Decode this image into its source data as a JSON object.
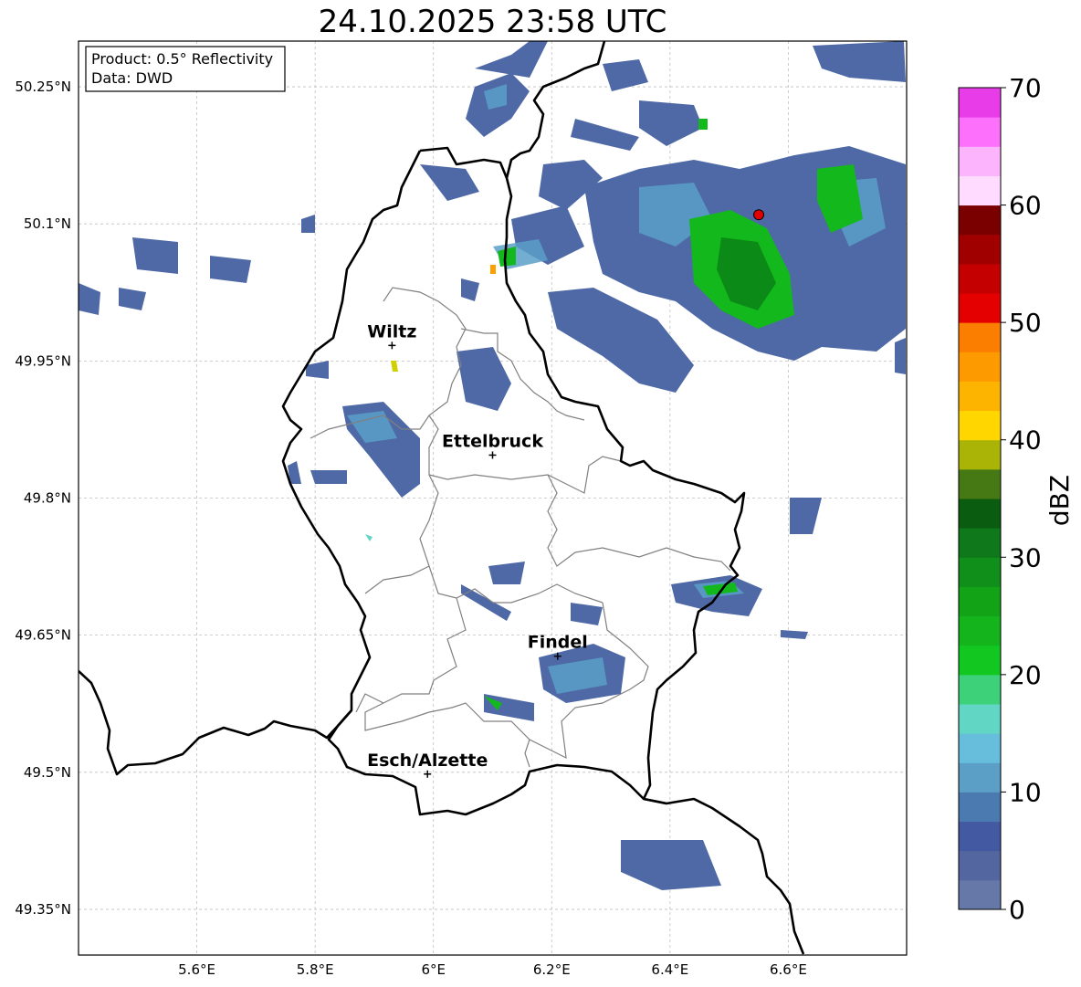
{
  "title": "24.10.2025 23:58 UTC",
  "info_box": {
    "product": "Product: 0.5° Reflectivity",
    "data": "Data: DWD"
  },
  "axes": {
    "lon_ticks": [
      "5.6°E",
      "5.8°E",
      "6°E",
      "6.2°E",
      "6.4°E",
      "6.6°E"
    ],
    "lon_values": [
      5.6,
      5.8,
      6.0,
      6.2,
      6.4,
      6.6
    ],
    "lat_ticks": [
      "50.25°N",
      "50.1°N",
      "49.95°N",
      "49.8°N",
      "49.65°N",
      "49.5°N",
      "49.35°N"
    ],
    "lat_values": [
      50.25,
      50.1,
      49.95,
      49.8,
      49.65,
      49.5,
      49.35
    ],
    "lon_range": [
      5.4,
      6.8
    ],
    "lat_range": [
      49.3,
      50.3
    ],
    "grid": true
  },
  "cities": [
    {
      "name": "Wiltz",
      "lon": 5.93,
      "lat": 49.967
    },
    {
      "name": "Ettelbruck",
      "lon": 6.1,
      "lat": 49.847
    },
    {
      "name": "Findel",
      "lon": 6.21,
      "lat": 49.627
    },
    {
      "name": "Esch/Alzette",
      "lon": 5.99,
      "lat": 49.498
    }
  ],
  "radar_site": {
    "lon": 6.55,
    "lat": 50.11,
    "color": "#e00000"
  },
  "colorbar": {
    "label": "dBZ",
    "ticks": [
      "0",
      "10",
      "20",
      "30",
      "40",
      "50",
      "60",
      "70"
    ],
    "min": 0,
    "max": 70,
    "colors": [
      "#6578a8",
      "#53669f",
      "#435aa3",
      "#4a7ab0",
      "#5b9ec6",
      "#67bedc",
      "#62d6c4",
      "#3dd27a",
      "#12c820",
      "#14b41c",
      "#12a416",
      "#10901a",
      "#0e781a",
      "#0a5c10",
      "#467814",
      "#aab406",
      "#ffd600",
      "#fcb400",
      "#fc9a00",
      "#fc7e00",
      "#e40000",
      "#c40000",
      "#a00000",
      "#7a0000",
      "#ffdcff",
      "#fcb4fc",
      "#fc70fc",
      "#e83ce8"
    ]
  }
}
